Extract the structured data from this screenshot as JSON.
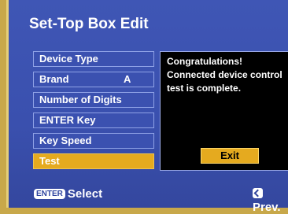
{
  "title": "Set-Top Box Edit",
  "menu": {
    "items": [
      {
        "label": "Device Type",
        "value": ""
      },
      {
        "label": "Brand",
        "value": "A"
      },
      {
        "label": "Number of Digits",
        "value": ""
      },
      {
        "label": "ENTER Key",
        "value": ""
      },
      {
        "label": "Key Speed",
        "value": ""
      },
      {
        "label": "Test",
        "value": "",
        "selected": true
      }
    ]
  },
  "panel": {
    "message": "Congratulations!\nConnected device control test is complete.",
    "exit_label": "Exit"
  },
  "footer": {
    "enter_key": "ENTER",
    "select_label": "Select",
    "prev_label": "Prev."
  },
  "colors": {
    "panel_blue": "#3f56b5",
    "highlight": "#e5aa1f",
    "message_bg": "#000000"
  },
  "icons": {
    "enter": "enter-key-icon",
    "prev": "return-icon"
  }
}
